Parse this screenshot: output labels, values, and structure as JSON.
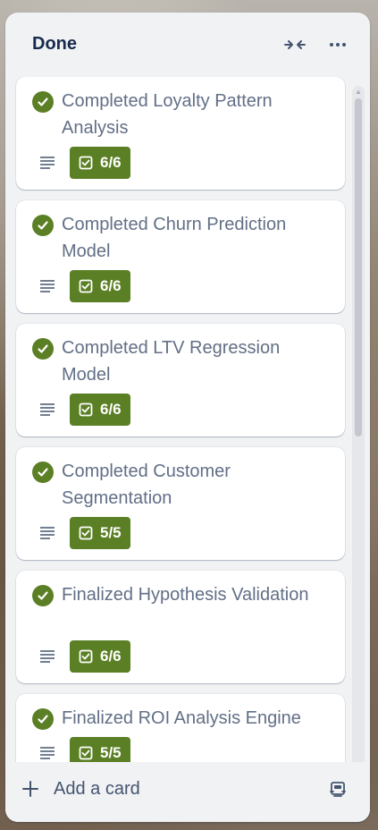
{
  "list": {
    "title": "Done",
    "collapse_icon": "collapse-arrows-icon",
    "more_icon": "more-horizontal-icon"
  },
  "cards": [
    {
      "title": "Completed Loyalty Pattern Analysis",
      "checklist": "6/6"
    },
    {
      "title": "Completed Churn Prediction Model",
      "checklist": "6/6"
    },
    {
      "title": "Completed LTV Regression Model",
      "checklist": "6/6"
    },
    {
      "title": "Completed Customer Segmentation",
      "checklist": "5/5"
    },
    {
      "title": "Finalized Hypothesis Validation",
      "checklist": "6/6"
    },
    {
      "title": "Finalized ROI Analysis Engine",
      "checklist": "5/5"
    }
  ],
  "footer": {
    "add_card_label": "Add a card",
    "template_icon": "card-template-icon"
  },
  "colors": {
    "done_green": "#5b7f24",
    "list_bg": "#f1f2f4",
    "card_title": "#626f86",
    "header_text": "#172b4d"
  }
}
